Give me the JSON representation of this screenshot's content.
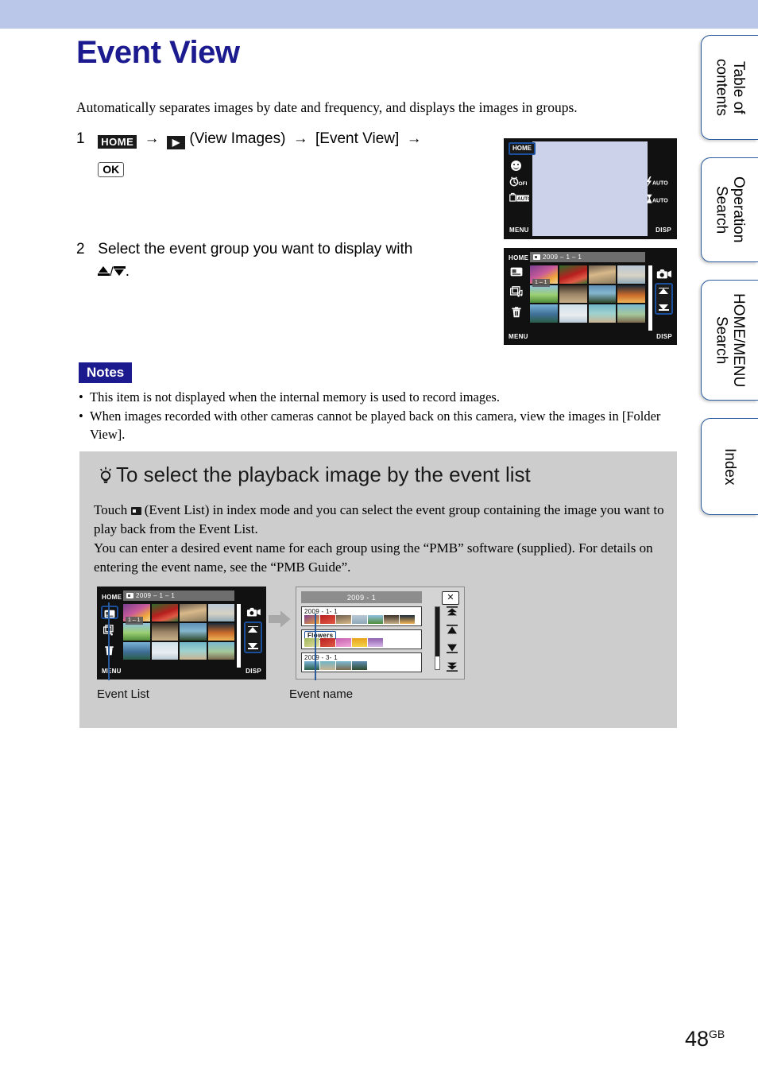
{
  "page": {
    "title": "Event View",
    "intro": "Automatically separates images by date and frequency, and displays the images in groups.",
    "number": "48",
    "number_suffix": "GB"
  },
  "steps": [
    {
      "num": "1",
      "home_key": "HOME",
      "play_icon": "▶",
      "view_images": "(View Images)",
      "event_view": "[Event View]",
      "ok_key": "OK",
      "arrow": "→"
    },
    {
      "num": "2",
      "text_before": "Select the event group you want to display with",
      "text_after": "."
    }
  ],
  "notes": {
    "label": "Notes",
    "items": [
      "This item is not displayed when the internal memory is used to record images.",
      "When images recorded with other cameras cannot be played back on this camera, view the images in [Folder View]."
    ],
    "bullet": "•"
  },
  "tip": {
    "heading": "To select the playback image by the event list",
    "paragraph1_a": "Touch",
    "paragraph1_b": "(Event List) in index mode and you can select the event group containing the image you want to play back from the Event List.",
    "paragraph2": "You can enter a desired event name for each group using the “PMB” software (supplied). For details on entering the event name, see the “PMB Guide”.",
    "caption_left": "Event List",
    "caption_right": "Event name"
  },
  "camera_screen_1": {
    "home": "HOME",
    "menu": "MENU",
    "disp": "DISP",
    "flash_auto": "AUTO",
    "macro_auto": "AUTO",
    "smiley_icon": "smile-shutter-icon",
    "timer_icon": "self-timer-off-icon",
    "burst_icon": "burst-auto-icon"
  },
  "camera_screen_2": {
    "home": "HOME",
    "menu": "MENU",
    "disp": "DISP",
    "gallery_title": "2009 – 1 – 1",
    "selected_badge": "1 – 1",
    "event_list_icon": "event-list-icon",
    "slideshow_icon": "slideshow-icon",
    "delete_icon": "trash-icon",
    "playback_icon": "playback-zoom-icon"
  },
  "illustration": {
    "left_screen": {
      "home": "HOME",
      "menu": "MENU",
      "disp": "DISP",
      "gallery_title": "2009 – 1 – 1",
      "selected_badge": "1 – 1"
    },
    "right_panel": {
      "header": "2009 - 1",
      "close": "✕",
      "rows": [
        {
          "label": "2009 - 1- 1",
          "highlighted": false,
          "thumbs": 7
        },
        {
          "label": "Flowers",
          "highlighted": true,
          "thumbs": 5
        },
        {
          "label": "2009 - 3- 1",
          "highlighted": false,
          "thumbs": 4
        }
      ],
      "nav_icons": [
        "jump-to-top-icon",
        "page-up-icon",
        "page-down-icon",
        "jump-to-bottom-icon"
      ]
    }
  },
  "sidebar": {
    "tabs": [
      {
        "label": "Table of\ncontents"
      },
      {
        "label": "Operation\nSearch"
      },
      {
        "label": "HOME/MENU\nSearch"
      },
      {
        "label": "Index"
      }
    ]
  },
  "colors": {
    "band": "#bac7e8",
    "title": "#1b1b8f",
    "notes_badge": "#1b1b8f",
    "tip_bg": "#cdcdcd",
    "highlight": "#1b4f9c"
  }
}
